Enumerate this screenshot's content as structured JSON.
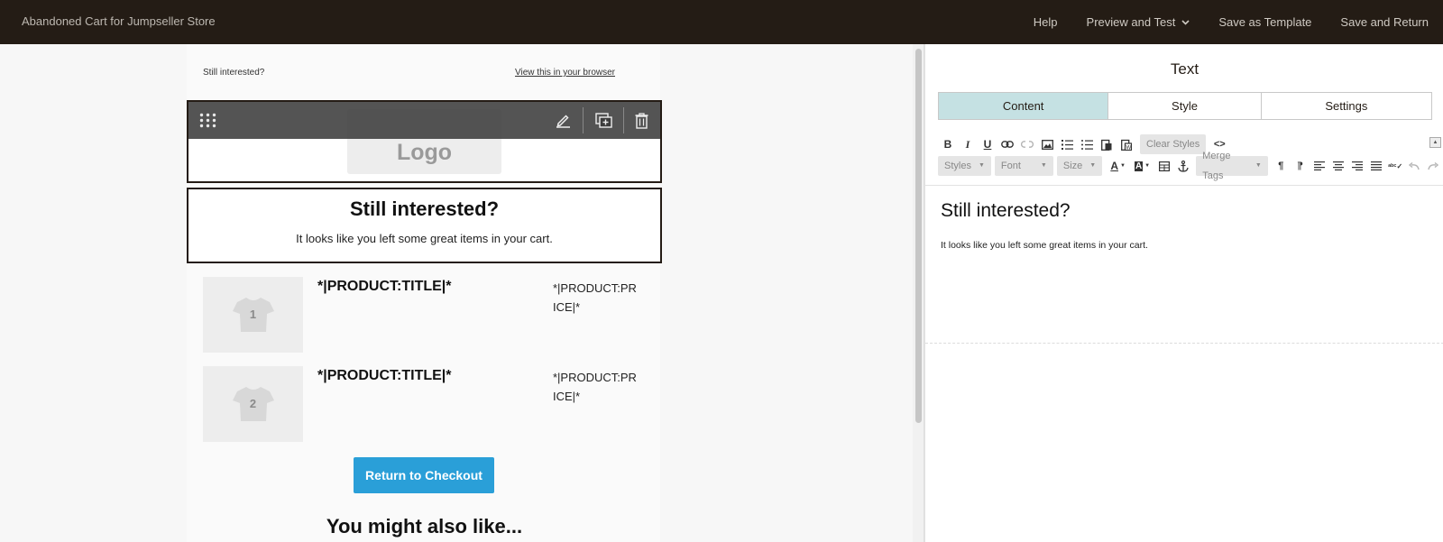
{
  "app": {
    "title": "Abandoned Cart for Jumpseller Store",
    "nav": {
      "help": "Help",
      "preview": "Preview and Test",
      "save_template": "Save as Template",
      "save_return": "Save and Return"
    }
  },
  "email": {
    "preheader": "Still interested?",
    "view_in_browser": "View this in your browser",
    "logo_placeholder": "Logo",
    "heading": "Still interested?",
    "subtext": "It looks like you left some great items in your cart.",
    "products": [
      {
        "index": "1",
        "title": "*|PRODUCT:TITLE|*",
        "price": "*|PRODUCT:PRICE|*"
      },
      {
        "index": "2",
        "title": "*|PRODUCT:TITLE|*",
        "price": "*|PRODUCT:PRICE|*"
      }
    ],
    "cta": "Return to Checkout",
    "also_like": "You might also like..."
  },
  "panel": {
    "title": "Text",
    "tabs": [
      "Content",
      "Style",
      "Settings"
    ],
    "active_tab": "Content",
    "toolbar": {
      "clear_styles": "Clear Styles",
      "styles": "Styles",
      "font": "Font",
      "size": "Size",
      "merge_tags": "Merge Tags"
    },
    "editor": {
      "heading": "Still interested?",
      "body": "It looks like you left some great items in your cart."
    }
  },
  "colors": {
    "topbar": "#241c15",
    "cta": "#2a9fd8",
    "active_tab": "#c5e1e3"
  }
}
